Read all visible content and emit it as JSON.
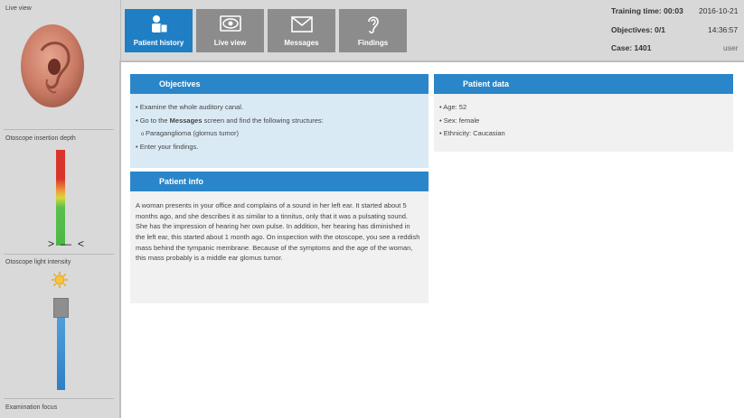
{
  "sidebar": {
    "live_view_label": "Live view",
    "insertion_depth_label": "Otoscope insertion depth",
    "depth_marker": ">—<",
    "light_intensity_label": "Otoscope light intensity",
    "examination_focus_label": "Examination focus",
    "ear_icon": "ear-image",
    "sun_icon": "sun-icon"
  },
  "tabs": [
    {
      "label": "Patient history",
      "icon": "patient-history-icon",
      "active": true
    },
    {
      "label": "Live view",
      "icon": "eye-icon",
      "active": false
    },
    {
      "label": "Messages",
      "icon": "envelope-icon",
      "active": false
    },
    {
      "label": "Findings",
      "icon": "ear-icon",
      "active": false
    }
  ],
  "status": {
    "training_time_label": "Training time: 00:03",
    "date": "2016-10-21",
    "objectives_label": "Objectives: 0/1",
    "time": "14:36:57",
    "case_label": "Case: 1401",
    "user": "user"
  },
  "objectives": {
    "title": "Objectives",
    "item1": "Examine the whole auditory canal.",
    "item2_pre": "Go to the ",
    "item2_bold": "Messages",
    "item2_post": " screen and find the following structures:",
    "sub1": "Paraganglioma (glomus tumor)",
    "item3": "Enter your findings."
  },
  "patient_data": {
    "title": "Patient data",
    "age": "Age: 52",
    "sex": "Sex: female",
    "ethnicity": "Ethnicity: Caucasian"
  },
  "patient_info": {
    "title": "Patient info",
    "text": "A woman presents in your office and complains of a sound in her left ear. It started about 5 months ago, and she describes it as similar to a tinnitus, only that it was a pulsating sound. She has the impression of hearing her own pulse. In addition, her hearing has diminished in the left ear, this started about 1 month ago. On inspection with the otoscope, you see a reddish mass behind the tympanic membrane. Because of the symptoms and the age of the woman, this mass probably is a middle ear glomus tumor."
  },
  "colors": {
    "accent": "#1f7ec4",
    "panel_header": "#2a86c9",
    "tab_inactive": "#8c8c8c"
  }
}
